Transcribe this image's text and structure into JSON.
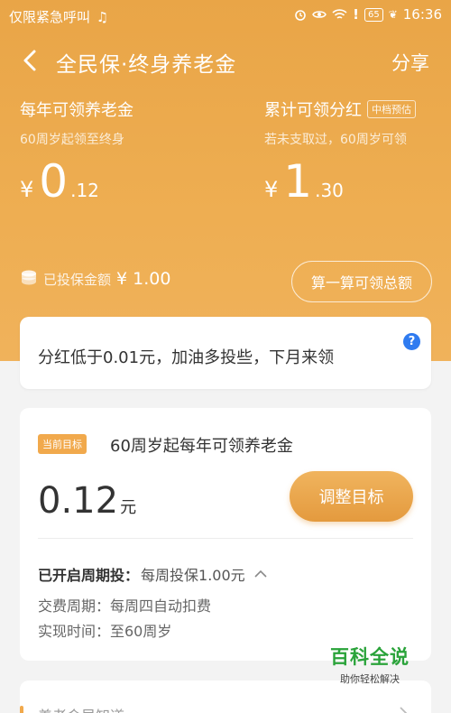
{
  "status_bar": {
    "left_text": "仅限紧急呼叫",
    "battery": "65",
    "time": "16:36"
  },
  "nav": {
    "title": "全民保·终身养老金",
    "share_label": "分享"
  },
  "annual_pension": {
    "label": "每年可领养老金",
    "sub": "60周岁起领至终身",
    "currency": "¥",
    "int": "0",
    "dec": ".12"
  },
  "dividend": {
    "label": "累计可领分红",
    "tag": "中档预估",
    "sub": "若未支取过，60周岁可领",
    "currency": "¥",
    "int": "1",
    "dec": ".30"
  },
  "invested": {
    "label": "已投保金额",
    "value": "¥ 1.00"
  },
  "calc_button": "算一算可领总额",
  "notice": {
    "text": "分红低于0.01元，加油多投些，下月来领",
    "help": "?"
  },
  "goal_card": {
    "badge": "当前目标",
    "goal_text": "60周岁起每年可领养老金",
    "amount": "0.12",
    "unit": "元",
    "adjust_button": "调整目标",
    "periodic_label": "已开启周期投：",
    "periodic_value": "每周投保1.00元",
    "rows": [
      {
        "text": "交费周期：每周四自动扣费"
      },
      {
        "text": "实现时间：至60周岁"
      }
    ]
  },
  "bottom_card": {
    "title": "养老金早知道"
  },
  "watermark": {
    "line1": "百科全说",
    "line2": "助你轻松解决"
  },
  "colors": {
    "hero": "#eeae52",
    "accent": "#f1a94c",
    "help_icon": "#2f7bf0",
    "watermark": "#2aa33a"
  },
  "icons": [
    "music-note-icon",
    "alarm-icon",
    "eye-icon",
    "wifi-icon",
    "alert-icon",
    "leaf-icon",
    "back-arrow-icon",
    "coin-stack-icon",
    "chevron-up-icon",
    "chevron-right-icon"
  ]
}
